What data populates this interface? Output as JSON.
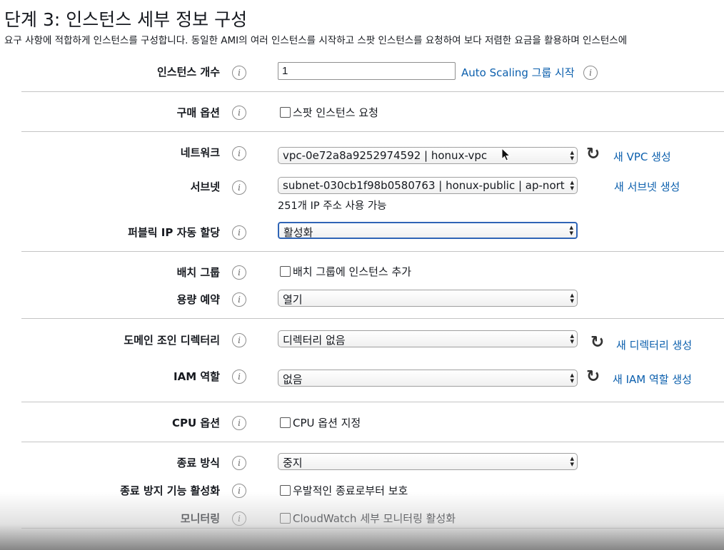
{
  "page": {
    "title": "단계 3: 인스턴스 세부 정보 구성",
    "subtitle": "요구 사항에 적합하게 인스턴스를 구성합니다. 동일한 AMI의 여러 인스턴스를 시작하고 스팟 인스턴스를 요청하여 보다 저렴한 요금을 활용하며 인스턴스에"
  },
  "form": {
    "instance_count": {
      "label": "인스턴스 개수",
      "value": "1",
      "link": "Auto Scaling 그룹 시작"
    },
    "purchase_option": {
      "label": "구매 옵션",
      "checkbox_label": "스팟 인스턴스 요청"
    },
    "network": {
      "label": "네트워크",
      "value": "vpc-0e72a8a9252974592 | honux-vpc",
      "link": "새 VPC 생성"
    },
    "subnet": {
      "label": "서브넷",
      "value": "subnet-030cb1f98b0580763 | honux-public | ap-nort",
      "link": "새 서브넷 생성",
      "helper": "251개 IP 주소 사용 가능"
    },
    "public_ip": {
      "label": "퍼블릭 IP 자동 할당",
      "value": "활성화"
    },
    "placement_group": {
      "label": "배치 그룹",
      "checkbox_label": "배치 그룹에 인스턴스 추가"
    },
    "capacity_reservation": {
      "label": "용량 예약",
      "value": "열기"
    },
    "domain_join": {
      "label": "도메인 조인 디렉터리",
      "value": "디렉터리 없음",
      "link": "새 디렉터리 생성"
    },
    "iam_role": {
      "label": "IAM 역할",
      "value": "없음",
      "link": "새 IAM 역할 생성"
    },
    "cpu_options": {
      "label": "CPU 옵션",
      "checkbox_label": "CPU 옵션 지정"
    },
    "shutdown_behavior": {
      "label": "종료 방식",
      "value": "중지"
    },
    "termination_protection": {
      "label": "종료 방지 기능 활성화",
      "checkbox_label": "우발적인 종료로부터 보호"
    },
    "monitoring": {
      "label": "모니터링",
      "checkbox_label": "CloudWatch 세부 모니터링 활성화"
    }
  },
  "icons": {
    "info": "info-icon",
    "refresh": "refresh-icon",
    "select_arrows": "up-down-arrows-icon",
    "cursor": "mouse-pointer-icon"
  },
  "colors": {
    "link": "#0b5fad",
    "focus_border": "#2f64b6",
    "divider": "#c4c4c4"
  }
}
